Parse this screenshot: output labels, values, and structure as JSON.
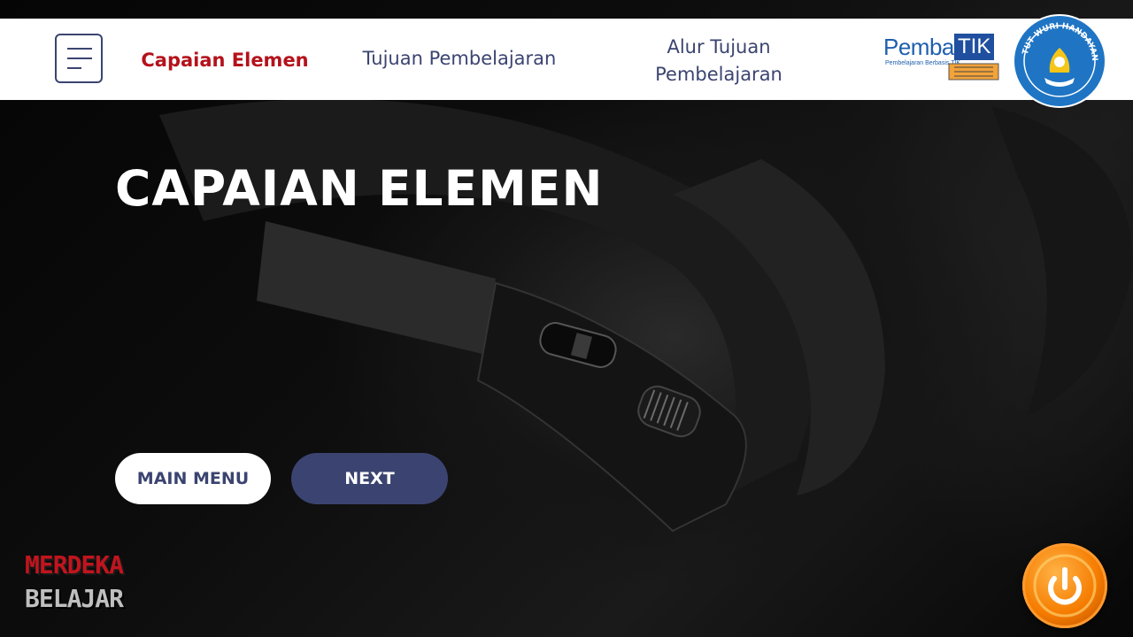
{
  "nav": {
    "items": [
      {
        "label": "Capaian Elemen",
        "active": true
      },
      {
        "label": "Tujuan Pembelajaran",
        "active": false
      },
      {
        "label": "Alur Tujuan Pembelajaran",
        "active": false
      }
    ],
    "menu_icon": "hamburger-icon"
  },
  "logos": {
    "pembatik_word": "Pemba",
    "pembatik_tik": "TIK",
    "pembatik_sub": "Pembelajaran Berbasis TIK",
    "seal_text": "TUT WURI HANDAYANI",
    "merdeka_line1": "MERDEKA",
    "merdeka_line2": "BELAJAR"
  },
  "main": {
    "title": "CAPAIAN ELEMEN",
    "buttons": {
      "main_menu": "MAIN MENU",
      "next": "NEXT"
    }
  },
  "power_icon": "power-icon",
  "colors": {
    "accent_red": "#b4121b",
    "navy": "#3b4470",
    "power_orange": "#f57c00"
  }
}
